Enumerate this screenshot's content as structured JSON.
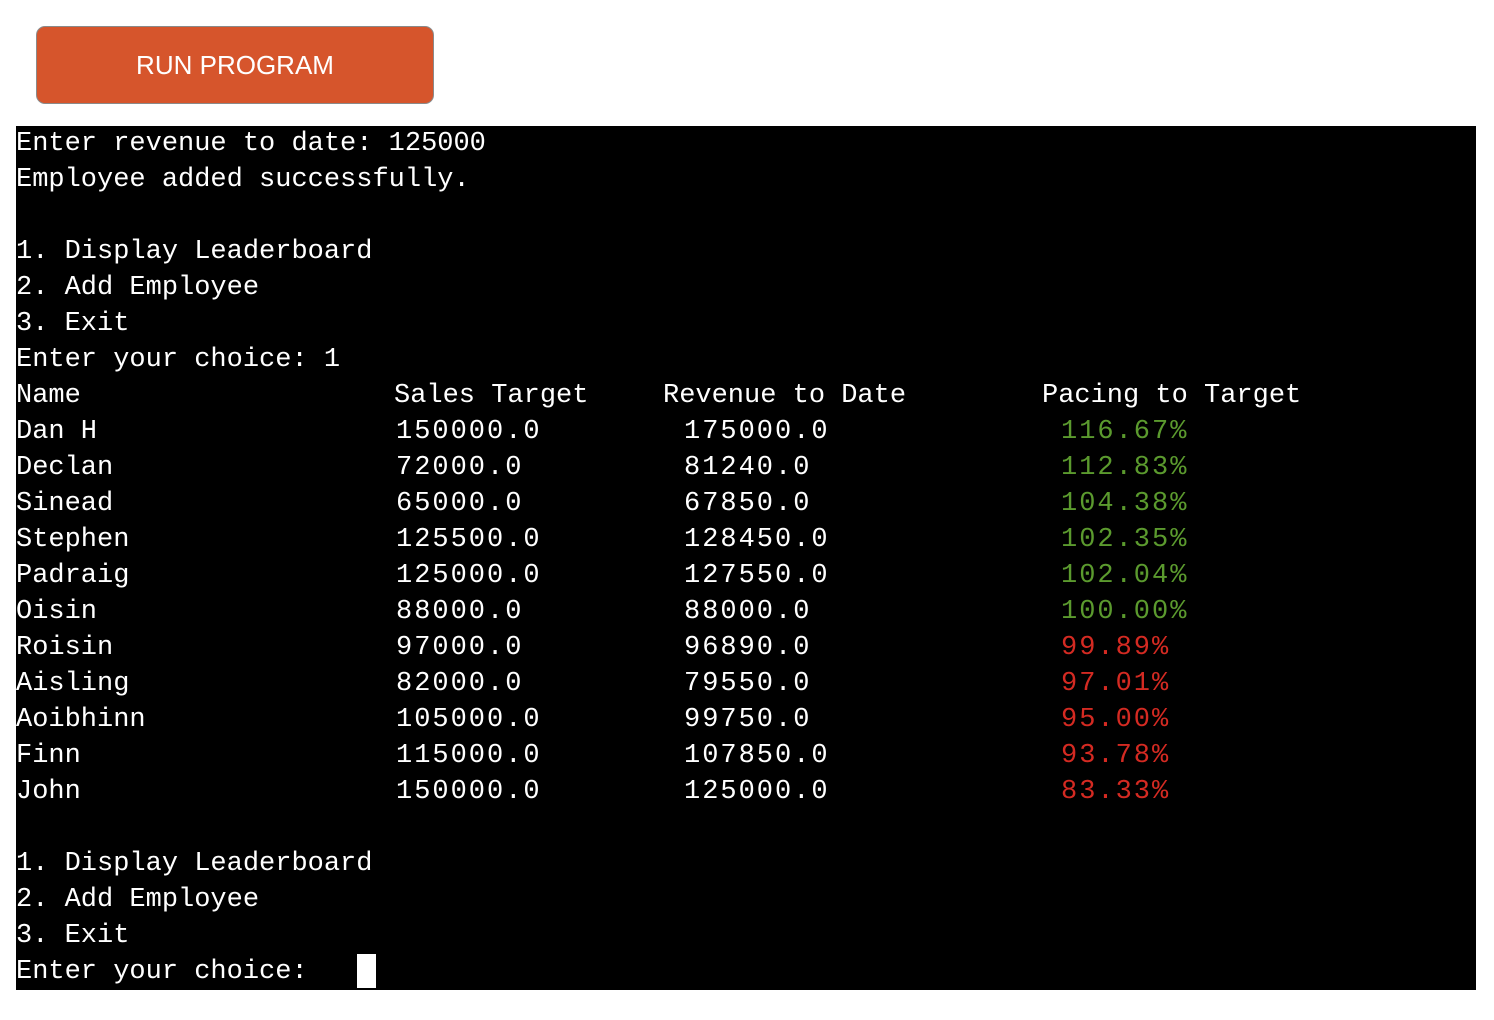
{
  "run_button": {
    "label": "RUN PROGRAM",
    "color": "#d6552c"
  },
  "terminal": {
    "background": "#000000",
    "pre_lines": [
      "Enter revenue to date: 125000",
      "Employee added successfully.",
      "",
      "1. Display Leaderboard",
      "2. Add Employee",
      "3. Exit",
      "Enter your choice: 1"
    ],
    "table_header": {
      "name": "Name",
      "sales_target": "Sales Target",
      "revenue": "Revenue to Date",
      "pacing": "Pacing to Target"
    },
    "rows": [
      {
        "name": "Dan H",
        "sales_target": "150000.0",
        "revenue": "175000.0",
        "pacing": "116.67%",
        "status": "above"
      },
      {
        "name": "Declan",
        "sales_target": "72000.0",
        "revenue": "81240.0",
        "pacing": "112.83%",
        "status": "above"
      },
      {
        "name": "Sinead",
        "sales_target": "65000.0",
        "revenue": "67850.0",
        "pacing": "104.38%",
        "status": "above"
      },
      {
        "name": "Stephen",
        "sales_target": "125500.0",
        "revenue": "128450.0",
        "pacing": "102.35%",
        "status": "above"
      },
      {
        "name": "Padraig",
        "sales_target": "125000.0",
        "revenue": "127550.0",
        "pacing": "102.04%",
        "status": "above"
      },
      {
        "name": "Oisin",
        "sales_target": "88000.0",
        "revenue": "88000.0",
        "pacing": "100.00%",
        "status": "above"
      },
      {
        "name": "Roisin",
        "sales_target": "97000.0",
        "revenue": "96890.0",
        "pacing": "99.89%",
        "status": "below"
      },
      {
        "name": "Aisling",
        "sales_target": "82000.0",
        "revenue": "79550.0",
        "pacing": "97.01%",
        "status": "below"
      },
      {
        "name": "Aoibhinn",
        "sales_target": "105000.0",
        "revenue": "99750.0",
        "pacing": "95.00%",
        "status": "below"
      },
      {
        "name": "Finn",
        "sales_target": "115000.0",
        "revenue": "107850.0",
        "pacing": "93.78%",
        "status": "below"
      },
      {
        "name": "John",
        "sales_target": "150000.0",
        "revenue": "125000.0",
        "pacing": "83.33%",
        "status": "below"
      }
    ],
    "post_lines": [
      "",
      "1. Display Leaderboard",
      "2. Add Employee",
      "3. Exit",
      "Enter your choice: "
    ],
    "colors": {
      "above_target": "#5b9a2e",
      "below_target": "#d42a22"
    }
  }
}
